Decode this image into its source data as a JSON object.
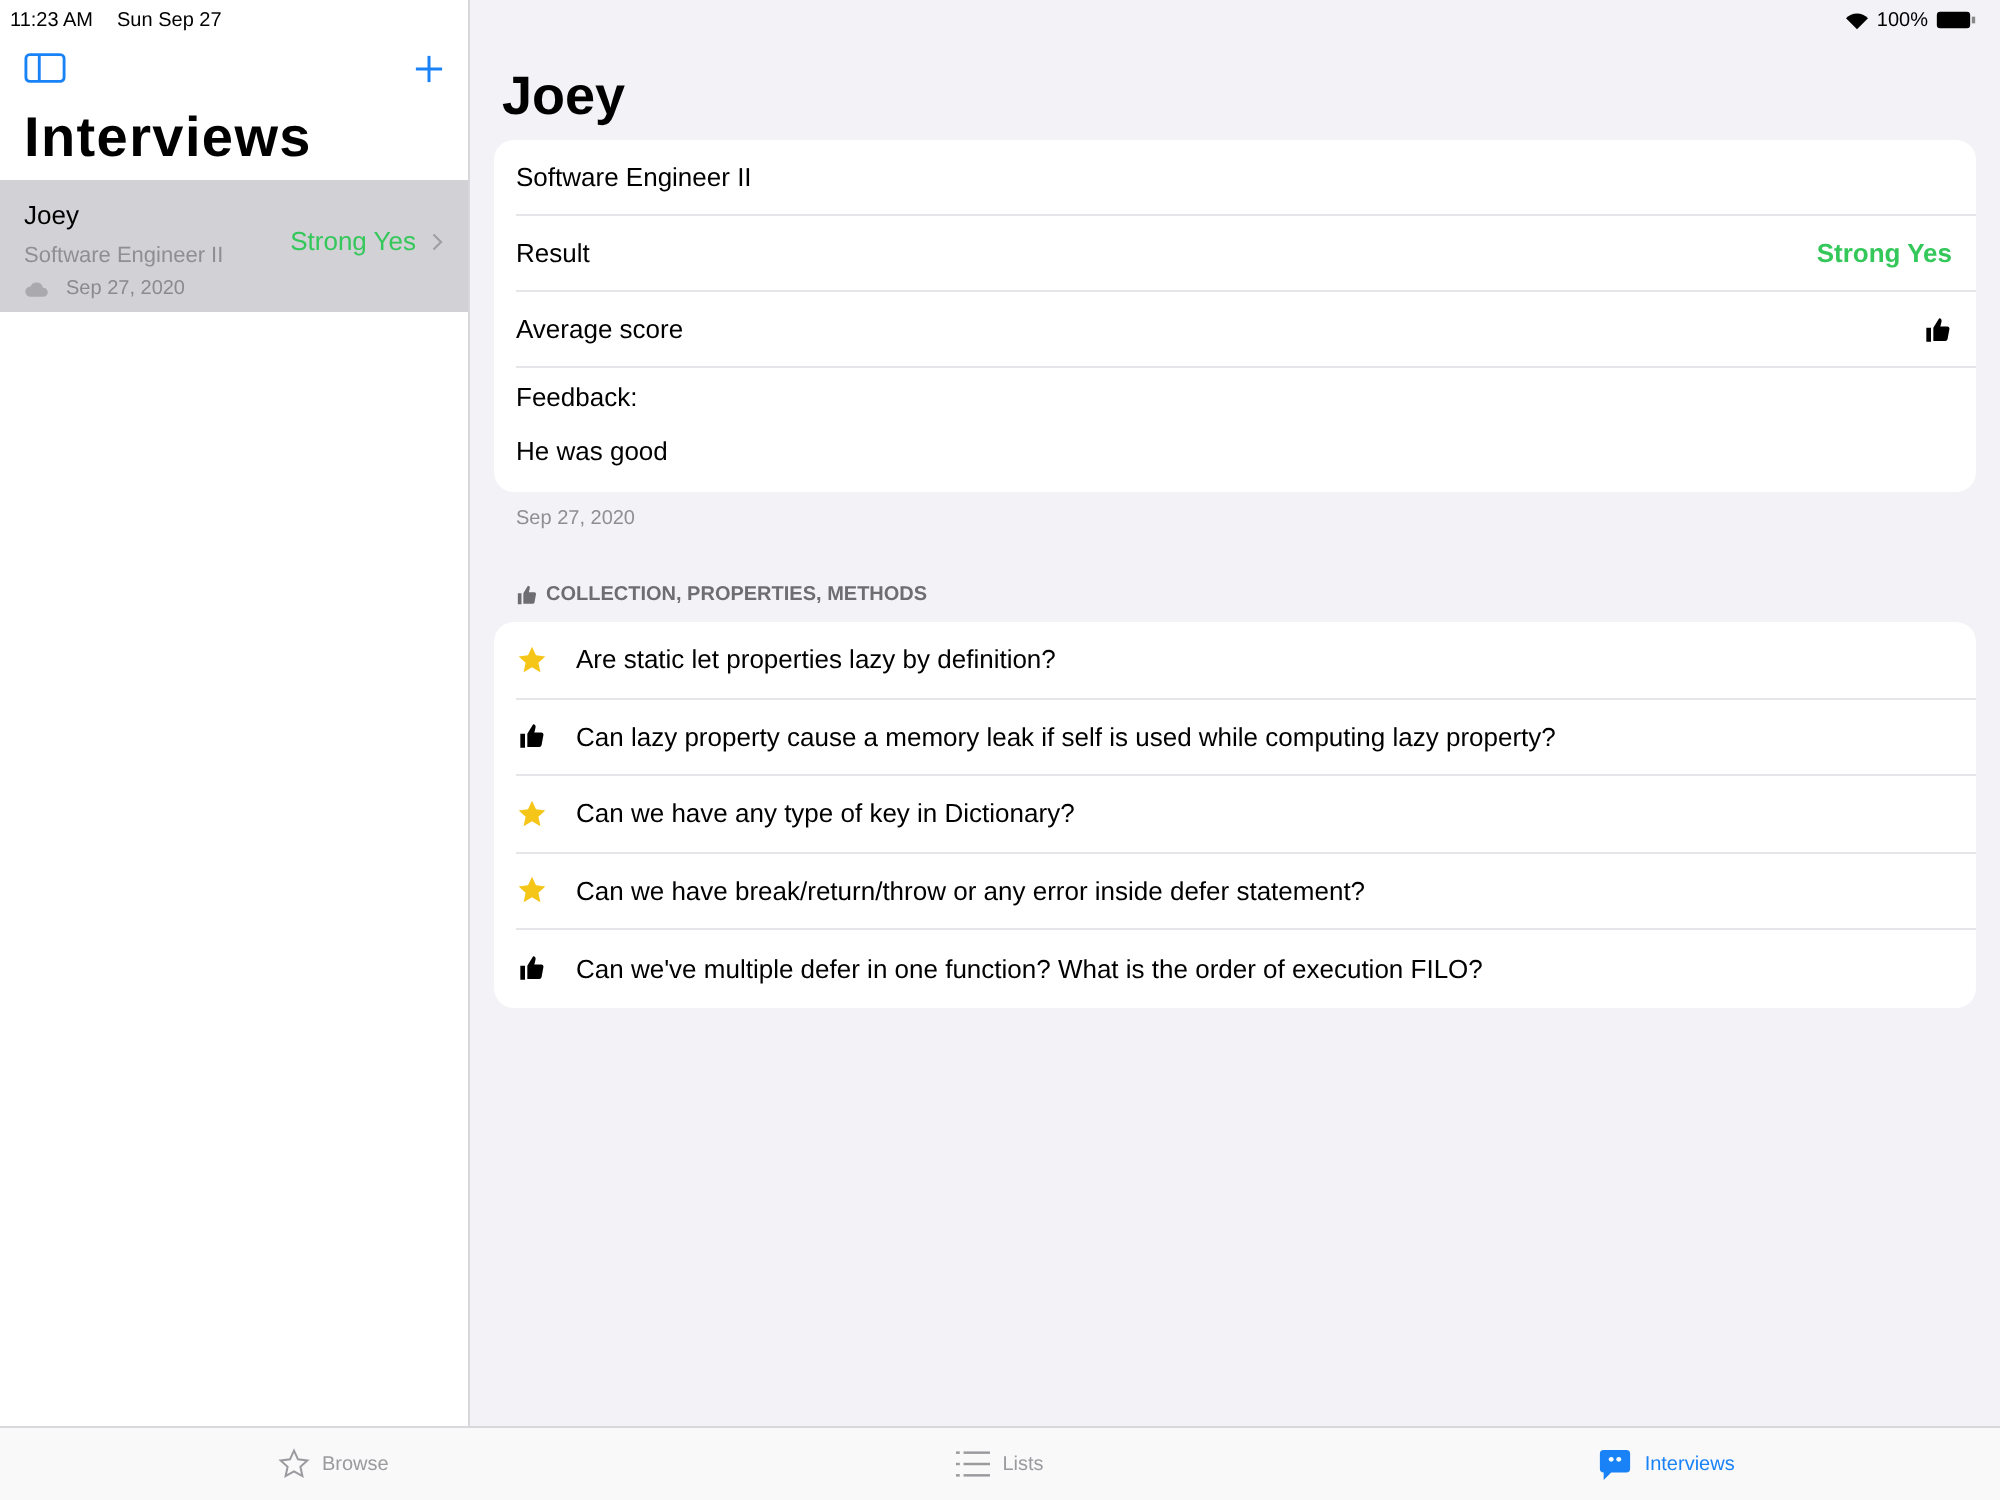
{
  "status_bar": {
    "time": "11:23 AM",
    "date": "Sun Sep 27",
    "battery": "100%"
  },
  "sidebar": {
    "title": "Interviews",
    "items": [
      {
        "name": "Joey",
        "role": "Software Engineer II",
        "date": "Sep 27, 2020",
        "result": "Strong Yes",
        "selected": true
      }
    ]
  },
  "detail": {
    "title": "Joey",
    "role": "Software Engineer II",
    "result_label": "Result",
    "result": "Strong Yes",
    "score_label": "Average score",
    "feedback_label": "Feedback:",
    "feedback": "He was good",
    "date": "Sep 27, 2020",
    "section_title": "COLLECTION, PROPERTIES, METHODS",
    "questions": [
      {
        "kind": "star",
        "text": "Are static let properties lazy by definition?"
      },
      {
        "kind": "thumb",
        "text": "Can lazy property cause a memory leak if self is used while computing lazy property?"
      },
      {
        "kind": "star",
        "text": "Can we have any type of key in Dictionary?"
      },
      {
        "kind": "star",
        "text": "Can we have break/return/throw or any error inside defer statement?"
      },
      {
        "kind": "thumb",
        "text": "Can we've multiple defer in one function? What is the order of execution FILO?"
      }
    ]
  },
  "tabs": [
    {
      "label": "Browse",
      "kind": "star",
      "selected": false
    },
    {
      "label": "Lists",
      "kind": "list",
      "selected": false
    },
    {
      "label": "Interviews",
      "kind": "quote",
      "selected": true
    }
  ]
}
